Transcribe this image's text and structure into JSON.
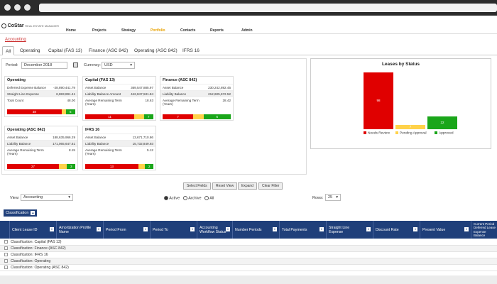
{
  "app": {
    "logo_brand": "CoStar",
    "logo_sub": "REAL ESTATE MANAGER"
  },
  "nav": [
    "Home",
    "Projects",
    "Strategy",
    "Portfolio",
    "Contacts",
    "Reports",
    "Admin"
  ],
  "breadcrumb": "Accounting",
  "tabs": [
    "All",
    "Operating",
    "Capital (FAS 13)",
    "Finance (ASC 842)",
    "Operating (ASC 842)",
    "IFRS 16"
  ],
  "period": {
    "label": "Period:",
    "value": "December 2018"
  },
  "currency": {
    "label": "Currency:",
    "value": "USD"
  },
  "cards": [
    {
      "title": "Operating",
      "rows": [
        [
          "Deferred Expense Balance",
          "-28,890,441.79"
        ],
        [
          "Straight Line Expense",
          "6,883,891.41"
        ],
        [
          "Total Count",
          "48.00"
        ]
      ],
      "bar": [
        {
          "label": "38",
          "pct": 0.8,
          "c": "red"
        },
        {
          "label": "",
          "pct": 0.06,
          "c": "yel"
        },
        {
          "label": "6",
          "pct": 0.14,
          "c": "grn"
        }
      ]
    },
    {
      "title": "Capital (FAS 13)",
      "rows": [
        [
          "Asset Balance",
          "369,547,885.97"
        ],
        [
          "Liability Balance Amount",
          "442,847,531.84"
        ],
        [
          "Average Remaining Term (Years)",
          "18.63"
        ]
      ],
      "bar": [
        {
          "label": "11",
          "pct": 0.72,
          "c": "red"
        },
        {
          "label": "",
          "pct": 0.14,
          "c": "yel"
        },
        {
          "label": "7",
          "pct": 0.14,
          "c": "grn"
        }
      ]
    },
    {
      "title": "Finance (ASC 842)",
      "rows": [
        [
          "Asset Balance",
          "230,242,892.45"
        ],
        [
          "Liability Balance",
          "212,605,672.52"
        ],
        [
          "Average Remaining Term (Years)",
          "28.42"
        ]
      ],
      "bar": [
        {
          "label": "7",
          "pct": 0.45,
          "c": "red"
        },
        {
          "label": "",
          "pct": 0.15,
          "c": "yel"
        },
        {
          "label": "6",
          "pct": 0.4,
          "c": "grn"
        }
      ]
    },
    {
      "title": "Operating (ASC 842)",
      "rows": [
        [
          "Asset Balance",
          "188,635,966.29"
        ],
        [
          "Liability Balance",
          "171,065,647.61"
        ],
        [
          "Average Remaining Term (Years)",
          "8.15"
        ]
      ],
      "bar": [
        {
          "label": "27",
          "pct": 0.76,
          "c": "red"
        },
        {
          "label": "",
          "pct": 0.12,
          "c": "yel"
        },
        {
          "label": "3",
          "pct": 0.12,
          "c": "grn"
        }
      ]
    },
    {
      "title": "IFRS 16",
      "rows": [
        [
          "Asset Balance",
          "13,671,710.86"
        ],
        [
          "Liability Balance",
          "15,732,849.93"
        ],
        [
          "Average Remaining Term (Years)",
          "5.12"
        ]
      ],
      "bar": [
        {
          "label": "13",
          "pct": 0.78,
          "c": "red"
        },
        {
          "label": "",
          "pct": 0.1,
          "c": "yel"
        },
        {
          "label": "2",
          "pct": 0.12,
          "c": "grn"
        }
      ]
    }
  ],
  "chart_data": {
    "type": "bar",
    "title": "Leases by Status",
    "categories": [
      "Needs Review",
      "Pending Approval",
      "Approved"
    ],
    "values": [
      98,
      7,
      22
    ],
    "ylim": [
      0,
      100
    ],
    "colors": [
      "#e00000",
      "#ffd24a",
      "#1aa61a"
    ],
    "legend": "bottom"
  },
  "buttons": [
    "Select Fields",
    "Reset View",
    "Expand",
    "Clear Filter"
  ],
  "view": {
    "label": "View:",
    "value": "Accounting"
  },
  "radios": [
    "Active",
    "Archive",
    "All"
  ],
  "rows_label": "Rows:",
  "rows_value": "25",
  "classification_btn": "Classification",
  "columns": [
    "Client Lease ID",
    "Amortization Profile Name",
    "Period From",
    "Period To",
    "Accounting Workflow Status",
    "Number Periods",
    "Total Payments",
    "Straight Line Expense",
    "Discount Rate",
    "Present Value",
    "Current Period Deferred Lease Expense Balance"
  ],
  "groups": [
    "Classification: Capital (FAS 13)",
    "Classification: Finance (ASC 842)",
    "Classification: IFRS 16",
    "Classification: Operating",
    "Classification: Operating (ASC 842)"
  ]
}
